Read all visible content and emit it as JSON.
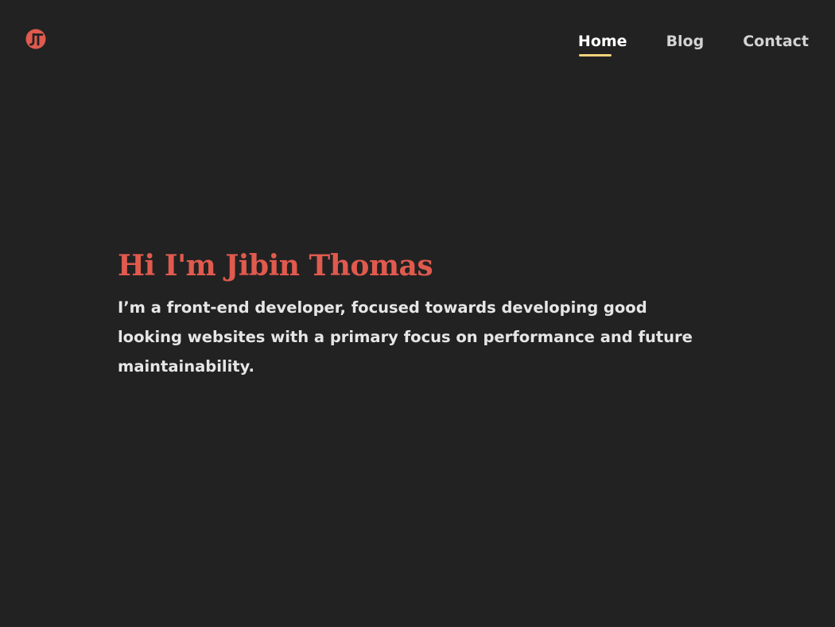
{
  "colors": {
    "background": "#222222",
    "accent": "#e05a4e",
    "nav_underline": "#f2d27a",
    "text": "#e6e6e6",
    "nav_text": "#d3d3d3",
    "nav_active_text": "#ffffff"
  },
  "header": {
    "logo_icon": "jt-monogram-icon",
    "nav": [
      {
        "label": "Home",
        "active": true
      },
      {
        "label": "Blog",
        "active": false
      },
      {
        "label": "Contact",
        "active": false
      }
    ]
  },
  "hero": {
    "title": "Hi I'm Jibin Thomas",
    "description": "I’m a front-end developer, focused towards developing good looking websites with a primary focus on performance and future maintainability."
  }
}
